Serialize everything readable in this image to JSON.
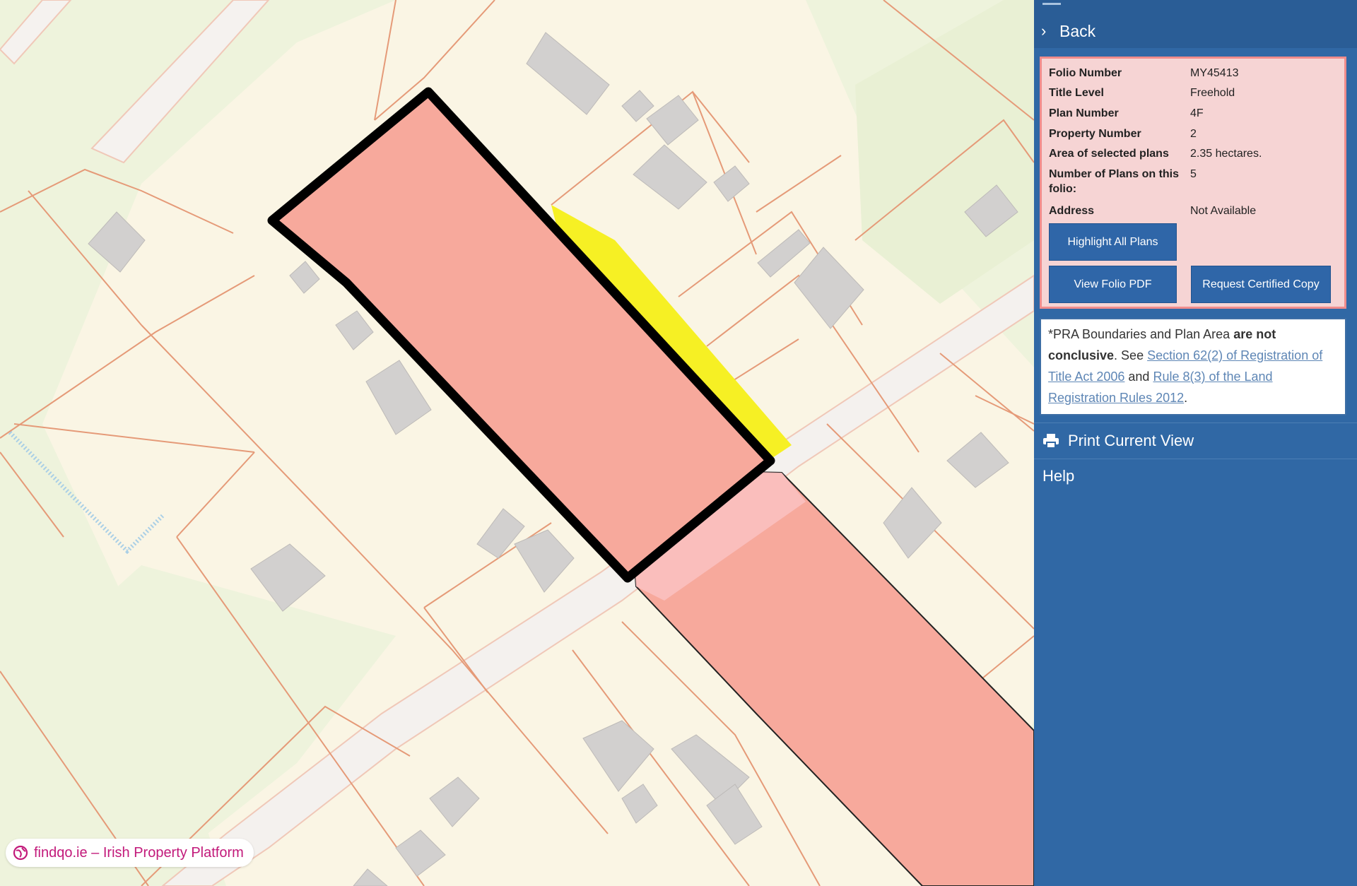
{
  "sidebar": {
    "back_label": "Back",
    "details": [
      {
        "label": "Folio Number",
        "value": "MY45413"
      },
      {
        "label": "Title Level",
        "value": "Freehold"
      },
      {
        "label": "Plan Number",
        "value": "4F"
      },
      {
        "label": "Property Number",
        "value": "2"
      },
      {
        "label": "Area of selected plans",
        "value": "2.35 hectares."
      },
      {
        "label": "Number of Plans on this folio:",
        "value": "5"
      },
      {
        "label": "Address",
        "value": "Not Available"
      }
    ],
    "buttons": {
      "highlight_all": "Highlight All Plans",
      "view_folio_pdf": "View Folio PDF",
      "request_certified": "Request Certified Copy"
    },
    "notice": {
      "prefix": "*PRA Boundaries and Plan Area ",
      "bold": "are not conclusive",
      "see": ". See ",
      "link1": "Section 62(2) of Registration of Title Act 2006",
      "and": " and ",
      "link2": "Rule 8(3) of the Land Registration Rules 2012",
      "suffix": "."
    },
    "print_label": "Print Current View",
    "help_label": "Help"
  },
  "watermark": {
    "text": "findqo.ie – Irish Property Platform",
    "icon": "globe-icon"
  },
  "icons": {
    "back": "chevron-right-icon",
    "print": "printer-icon"
  },
  "colors": {
    "sidebar_bg": "#3068a5",
    "panel_bg": "#f6d4d4",
    "parcel_fill": "#f7a99c",
    "highlight": "#f6f024",
    "button_bg": "#2f66a8",
    "brand": "#c2197a"
  }
}
